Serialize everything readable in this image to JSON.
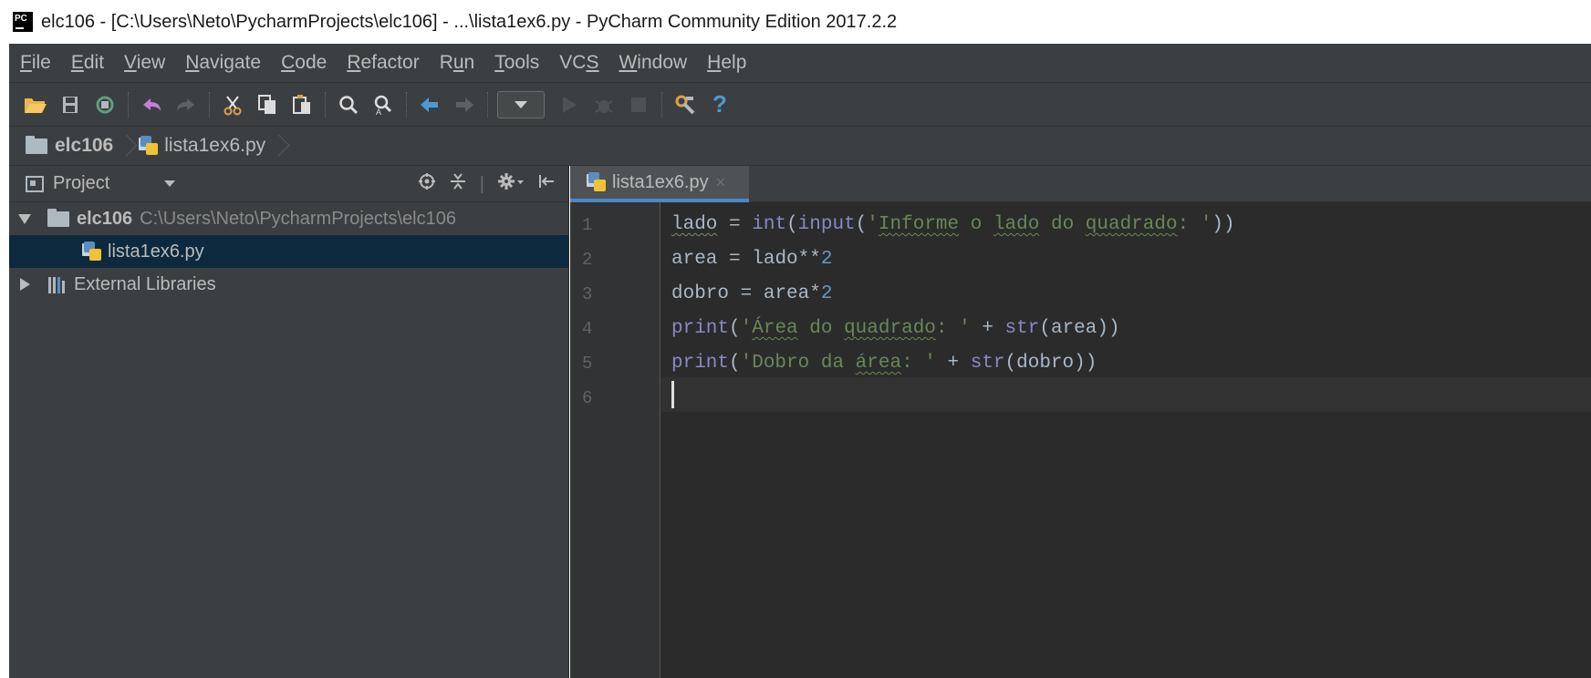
{
  "titlebar": {
    "title": "elc106 - [C:\\Users\\Neto\\PycharmProjects\\elc106] - ...\\lista1ex6.py - PyCharm Community Edition 2017.2.2"
  },
  "menu": {
    "items": [
      {
        "label": "File",
        "mnemonic": "F"
      },
      {
        "label": "Edit",
        "mnemonic": "E"
      },
      {
        "label": "View",
        "mnemonic": "V"
      },
      {
        "label": "Navigate",
        "mnemonic": "N"
      },
      {
        "label": "Code",
        "mnemonic": "C"
      },
      {
        "label": "Refactor",
        "mnemonic": "R"
      },
      {
        "label": "Run",
        "mnemonic": "u"
      },
      {
        "label": "Tools",
        "mnemonic": "T"
      },
      {
        "label": "VCS",
        "mnemonic": "S"
      },
      {
        "label": "Window",
        "mnemonic": "W"
      },
      {
        "label": "Help",
        "mnemonic": "H"
      }
    ]
  },
  "toolbar": {
    "icons": [
      "open-folder-icon",
      "save-icon",
      "sync-icon",
      "undo-icon",
      "redo-icon",
      "cut-icon",
      "copy-icon",
      "paste-icon",
      "find-icon",
      "replace-icon",
      "back-icon",
      "forward-icon",
      "run-config-dropdown",
      "run-icon",
      "debug-icon",
      "stop-icon",
      "settings-wrench-icon",
      "help-icon"
    ]
  },
  "breadcrumb": {
    "project": "elc106",
    "file": "lista1ex6.py"
  },
  "project_panel": {
    "title": "Project",
    "tree": {
      "root_name": "elc106",
      "root_path": "C:\\Users\\Neto\\PycharmProjects\\elc106",
      "file": "lista1ex6.py",
      "external": "External Libraries"
    }
  },
  "editor": {
    "tab_label": "lista1ex6.py",
    "tab_close": "×",
    "line_numbers": [
      "1",
      "2",
      "3",
      "4",
      "5",
      "6"
    ],
    "lines": [
      "lado = int(input('Informe o lado do quadrado: '))",
      "area = lado**2",
      "dobro = area*2",
      "print('Área do quadrado: ' + str(area))",
      "print('Dobro da área: ' + str(dobro))",
      ""
    ]
  },
  "colors": {
    "panel_bg": "#3c3f41",
    "editor_bg": "#2b2b2b",
    "selection": "#0d293e",
    "string": "#6a8759",
    "builtin": "#8888c6",
    "number": "#6897bb",
    "accent_tab": "#4a88c7"
  }
}
